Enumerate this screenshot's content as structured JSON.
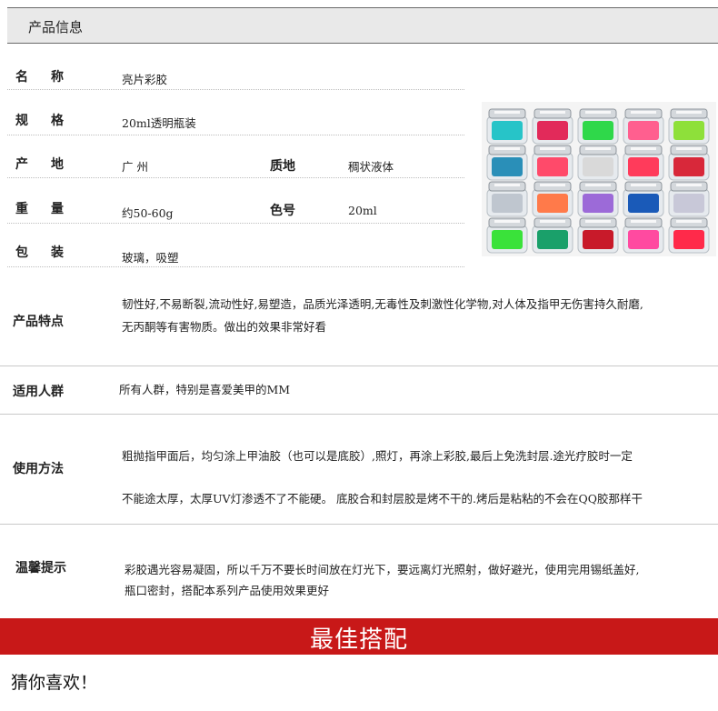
{
  "header": {
    "title": "产品信息"
  },
  "specs": {
    "name_label_1": "名",
    "name_label_2": "称",
    "name_value": "亮片彩胶",
    "spec_label_1": "规",
    "spec_label_2": "格",
    "spec_value": "20ml透明瓶装",
    "origin_label_1": "产",
    "origin_label_2": "地",
    "origin_value": "广 州",
    "texture_label": "质地",
    "texture_value": "稠状液体",
    "weight_label_1": "重",
    "weight_label_2": "量",
    "weight_value": "约50-60g",
    "color_label": "色号",
    "color_value": "20ml",
    "pack_label_1": "包",
    "pack_label_2": "装",
    "pack_value": "玻璃，吸塑"
  },
  "features": {
    "label": "产品特点",
    "line1": "韧性好,不易断裂,流动性好,易塑造，品质光泽透明,无毒性及刺激性化学物,对人体及指甲无伤害持久耐磨,",
    "line2": "无丙酮等有害物质。做出的效果非常好看"
  },
  "audience": {
    "label": "适用人群",
    "text": "所有人群，特别是喜爱美甲的MM"
  },
  "usage": {
    "label": "使用方法",
    "line1": "粗抛指甲面后，均匀涂上甲油胶（也可以是底胶）,照灯，再涂上彩胶,最后上免洗封层.途光疗胶时一定",
    "line2": "不能途太厚，太厚UV灯渗透不了不能硬。 底胶合和封层胶是烤不干的.烤后是粘粘的不会在QQ胶那样干"
  },
  "tips": {
    "label": "温馨提示",
    "line1": "彩胶遇光容易凝固，所以千万不要长时间放在灯光下，要远离灯光照射，做好避光，使用完用锡纸盖好,",
    "line2": "瓶口密封，搭配本系列产品使用效果更好"
  },
  "banner": {
    "title": "最佳搭配"
  },
  "guess": {
    "title": "猜你喜欢！"
  },
  "jar_colors": [
    [
      "#27c4c8",
      "#e22a5a",
      "#2fd84a",
      "#ff5f8f",
      "#8ee03a"
    ],
    [
      "#2a8fb8",
      "#ff4a6a",
      "#d9d9d9",
      "#ff3b5b",
      "#d8283a"
    ],
    [
      "#bfc6cf",
      "#ff7a4a",
      "#9c6ad8",
      "#1a5ab8",
      "#c8c8d8"
    ],
    [
      "#3ae23a",
      "#1aa06a",
      "#c81a2a",
      "#ff4aa0",
      "#ff2a4a"
    ]
  ]
}
